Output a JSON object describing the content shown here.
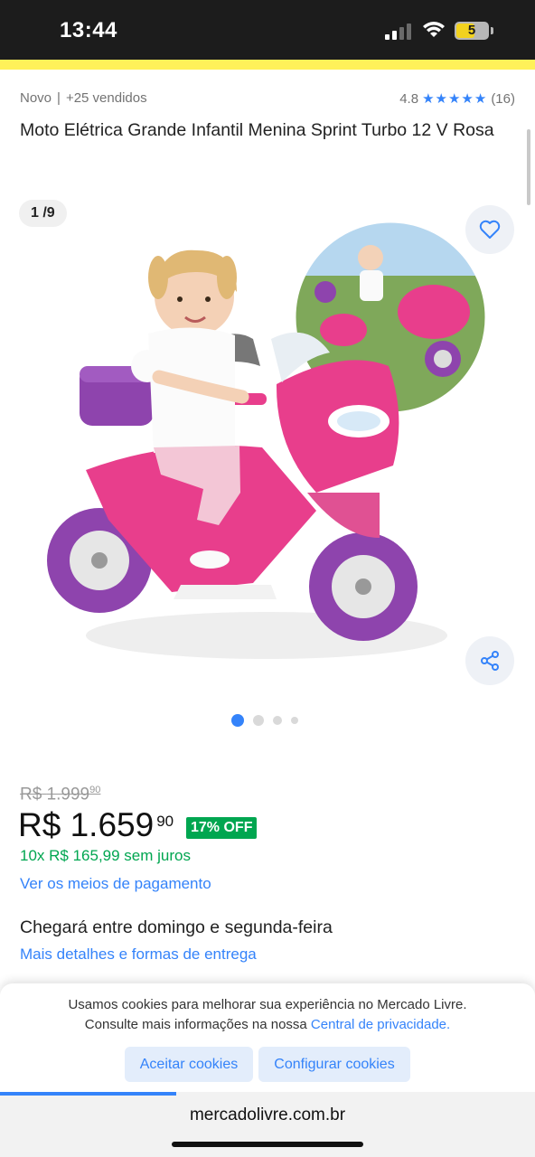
{
  "status_bar": {
    "time": "13:44",
    "battery": "5",
    "battery_percent": 50
  },
  "header": {
    "condition": "Novo",
    "sold": "+25 vendidos",
    "rating": "4.8",
    "rating_stars": 5,
    "review_count": "(16)"
  },
  "product": {
    "title": "Moto Elétrica Grande Infantil Menina Sprint Turbo 12 V Rosa",
    "image_counter": "1 /9",
    "image_icon": "kids-pink-electric-motorcycle-photo",
    "image_dots": 4,
    "active_dot": 0
  },
  "pricing": {
    "old_price_currency": "R$",
    "old_price": "1.999",
    "old_price_cents": "90",
    "currency": "R$",
    "price": "1.659",
    "price_cents": "90",
    "discount": "17% OFF",
    "installments": "10x R$ 165,99 sem juros",
    "payment_link": "Ver os meios de pagamento"
  },
  "delivery": {
    "title": "Chegará entre domingo e segunda-feira",
    "link": "Mais detalhes e formas de entrega"
  },
  "cookies": {
    "line1": "Usamos cookies para melhorar sua experiência no Mercado Livre.",
    "line2_prefix": "Consulte mais informações na nossa ",
    "line2_link": "Central de privacidade.",
    "accept": "Aceitar cookies",
    "configure": "Configurar cookies"
  },
  "browser": {
    "url": "mercadolivre.com.br",
    "load_progress": 0.33
  },
  "colors": {
    "accent_blue": "#3483fa",
    "green": "#00a650",
    "ml_yellow": "#fff159",
    "product_pink": "#e83e8c",
    "product_purple": "#8e44ad"
  }
}
